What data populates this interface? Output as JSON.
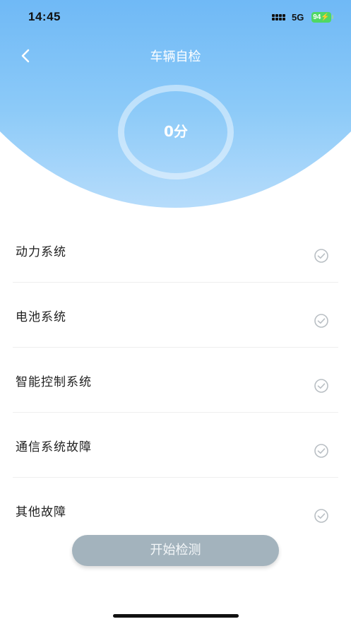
{
  "status_bar": {
    "time": "14:45",
    "network": "5G",
    "battery": "94",
    "battery_color": "#4fd864"
  },
  "header": {
    "title": "车辆自检",
    "back_icon": "chevron-left-icon",
    "gradient_top": "#3f98f1",
    "gradient_bottom": "#b6dcfb"
  },
  "score": {
    "text": "0分",
    "value": 0
  },
  "check_items": [
    {
      "label": "动力系统",
      "icon": "check-circle-icon"
    },
    {
      "label": "电池系统",
      "icon": "check-circle-icon"
    },
    {
      "label": "智能控制系统",
      "icon": "check-circle-icon"
    },
    {
      "label": "通信系统故障",
      "icon": "check-circle-icon"
    },
    {
      "label": "其他故障",
      "icon": "check-circle-icon"
    }
  ],
  "start_button": {
    "label": "开始检测",
    "color": "#a3b3bd"
  }
}
